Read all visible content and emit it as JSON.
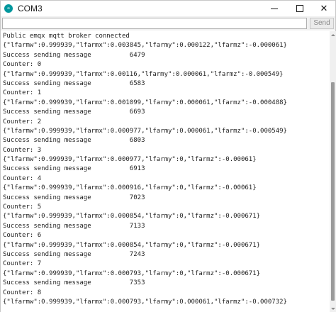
{
  "window": {
    "title": "COM3",
    "icon": "arduino-icon",
    "icon_text": "∞",
    "controls": [
      "minimize",
      "maximize",
      "close"
    ],
    "close_glyph": "✕"
  },
  "input_bar": {
    "value": "",
    "placeholder": "",
    "send_label": "Send"
  },
  "serial_output": {
    "lines": [
      "Public emqx mqtt broker connected",
      "{\"lfarmw\":0.999939,\"lfarmx\":0.003845,\"lfarmy\":0.000122,\"lfarmz\":-0.000061}",
      "Success sending message          6479",
      "Counter: 0",
      "{\"lfarmw\":0.999939,\"lfarmx\":0.00116,\"lfarmy\":0.000061,\"lfarmz\":-0.000549}",
      "Success sending message          6583",
      "Counter: 1",
      "{\"lfarmw\":0.999939,\"lfarmx\":0.001099,\"lfarmy\":0.000061,\"lfarmz\":-0.000488}",
      "Success sending message          6693",
      "Counter: 2",
      "{\"lfarmw\":0.999939,\"lfarmx\":0.000977,\"lfarmy\":0.000061,\"lfarmz\":-0.000549}",
      "Success sending message          6803",
      "Counter: 3",
      "{\"lfarmw\":0.999939,\"lfarmx\":0.000977,\"lfarmy\":0,\"lfarmz\":-0.00061}",
      "Success sending message          6913",
      "Counter: 4",
      "{\"lfarmw\":0.999939,\"lfarmx\":0.000916,\"lfarmy\":0,\"lfarmz\":-0.00061}",
      "Success sending message          7023",
      "Counter: 5",
      "{\"lfarmw\":0.999939,\"lfarmx\":0.000854,\"lfarmy\":0,\"lfarmz\":-0.000671}",
      "Success sending message          7133",
      "Counter: 6",
      "{\"lfarmw\":0.999939,\"lfarmx\":0.000854,\"lfarmy\":0,\"lfarmz\":-0.000671}",
      "Success sending message          7243",
      "Counter: 7",
      "{\"lfarmw\":0.999939,\"lfarmx\":0.000793,\"lfarmy\":0,\"lfarmz\":-0.000671}",
      "Success sending message          7353",
      "Counter: 8",
      "{\"lfarmw\":0.999939,\"lfarmx\":0.000793,\"lfarmy\":0.000061,\"lfarmz\":-0.000732}"
    ]
  }
}
